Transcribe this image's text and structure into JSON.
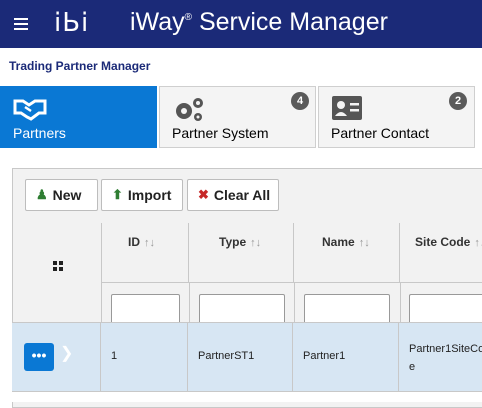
{
  "header": {
    "logo": "iЬi",
    "title": "iWay",
    "trademark": "®",
    "title_rest": " Service Manager"
  },
  "breadcrumb": "Trading Partner Manager",
  "tabs": [
    {
      "label": "Partners",
      "icon": "handshake-icon",
      "badge": ""
    },
    {
      "label": "Partner System",
      "icon": "gears-icon",
      "badge": "4"
    },
    {
      "label": "Partner Contact",
      "icon": "contact-card-icon",
      "badge": "2"
    }
  ],
  "toolbar": {
    "new_label": "New",
    "import_label": "Import",
    "clear_label": "Clear All"
  },
  "grid": {
    "columns": [
      "ID",
      "Type",
      "Name",
      "Site Code"
    ],
    "sort_glyph": "↑↓",
    "rows": [
      {
        "id": "1",
        "type": "PartnerST1",
        "name": "Partner1",
        "site_code_line1": "Partner1SiteCo",
        "site_code_line2": "e"
      }
    ]
  },
  "colors": {
    "topbar": "#1b2a78",
    "accent": "#0a78d4",
    "selected_row": "#d7e6f3"
  }
}
